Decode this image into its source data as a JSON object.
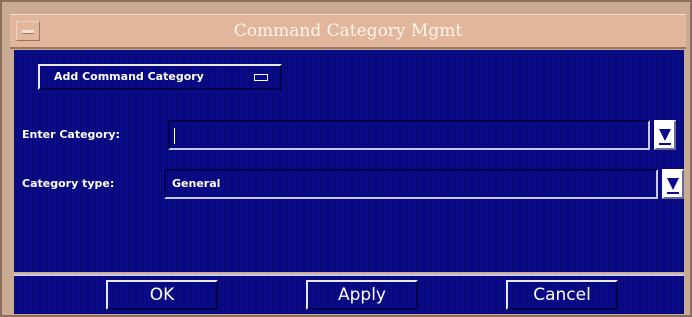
{
  "window": {
    "title": "Command Category Mgmt"
  },
  "form": {
    "mode_option": "Add Command Category",
    "category_label": "Enter Category:",
    "category_value": "",
    "type_label": "Category type:",
    "type_value": "General"
  },
  "buttons": {
    "ok": "OK",
    "apply": "Apply",
    "cancel": "Cancel"
  },
  "colors": {
    "titlebar": "#e2b69a",
    "panel": "#0a0a8c",
    "frame": "#c9aa92"
  }
}
